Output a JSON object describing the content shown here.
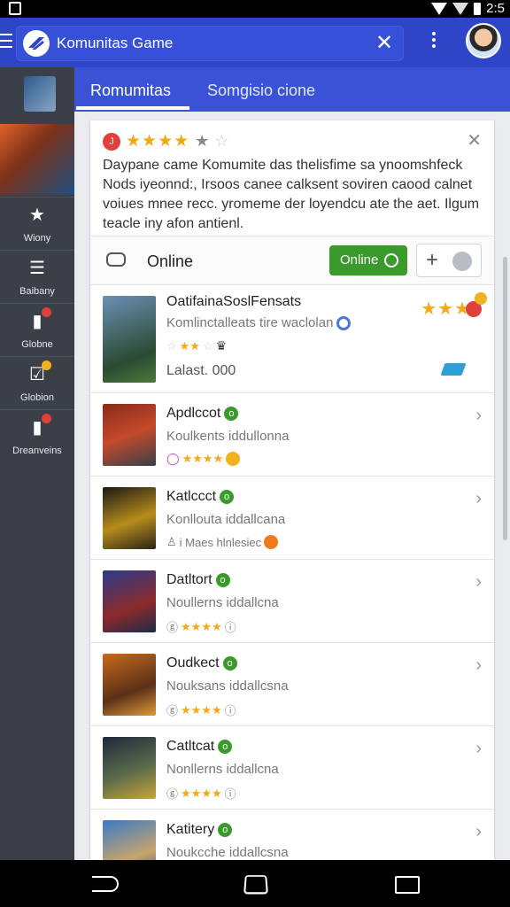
{
  "status_bar": {
    "time": "2:5"
  },
  "app_bar": {
    "title": "Komunitas Game"
  },
  "rail": {
    "items": [
      {
        "label": "Wiony"
      },
      {
        "label": "Baibany"
      },
      {
        "label": "Globne"
      },
      {
        "label": "Globion"
      },
      {
        "label": "Dreanveins"
      }
    ]
  },
  "tabs": [
    {
      "label": "Romumitas"
    },
    {
      "label": "Somgisio cione"
    }
  ],
  "info_card": {
    "badge": "J",
    "text": "Daypane came  Komumite das thelisfime sa ynoomshfeck Nods iyeonnd:, Irsoos canee calksent soviren caood calnet voiues mnee recc. yromeme der loyendcu ate the aet. Ilgum teacle iny afon antienl."
  },
  "online_bar": {
    "label": "Online",
    "button_label": "Online"
  },
  "games": [
    {
      "title": "OatifainaSoslFensats",
      "subtitle": "Komlinctalleats tire waclolan",
      "last": "Lalast. 000",
      "featured": true
    },
    {
      "title": "Apdlccot",
      "subtitle": "Koulkents iddullonna",
      "meta_text": ""
    },
    {
      "title": "Katlccct",
      "subtitle": "Konllouta iddallcana",
      "meta_text": "i Maes hlnlesiec"
    },
    {
      "title": "Datltort",
      "subtitle": "Noullerns iddallcna",
      "meta_text": ""
    },
    {
      "title": "Oudkect",
      "subtitle": "Nouksans iddallcsna",
      "meta_text": ""
    },
    {
      "title": "Catltcat",
      "subtitle": "Nonllerns iddallcna",
      "meta_text": ""
    },
    {
      "title": "Katitery",
      "subtitle": "Noukcche iddallcsna",
      "meta_text": ""
    }
  ],
  "colors": {
    "app_bar": "#2f45c8",
    "tabs": "#3a53d6",
    "rail": "#3a3f48",
    "online_green": "#3a9a2c",
    "star": "#f3a81a"
  }
}
